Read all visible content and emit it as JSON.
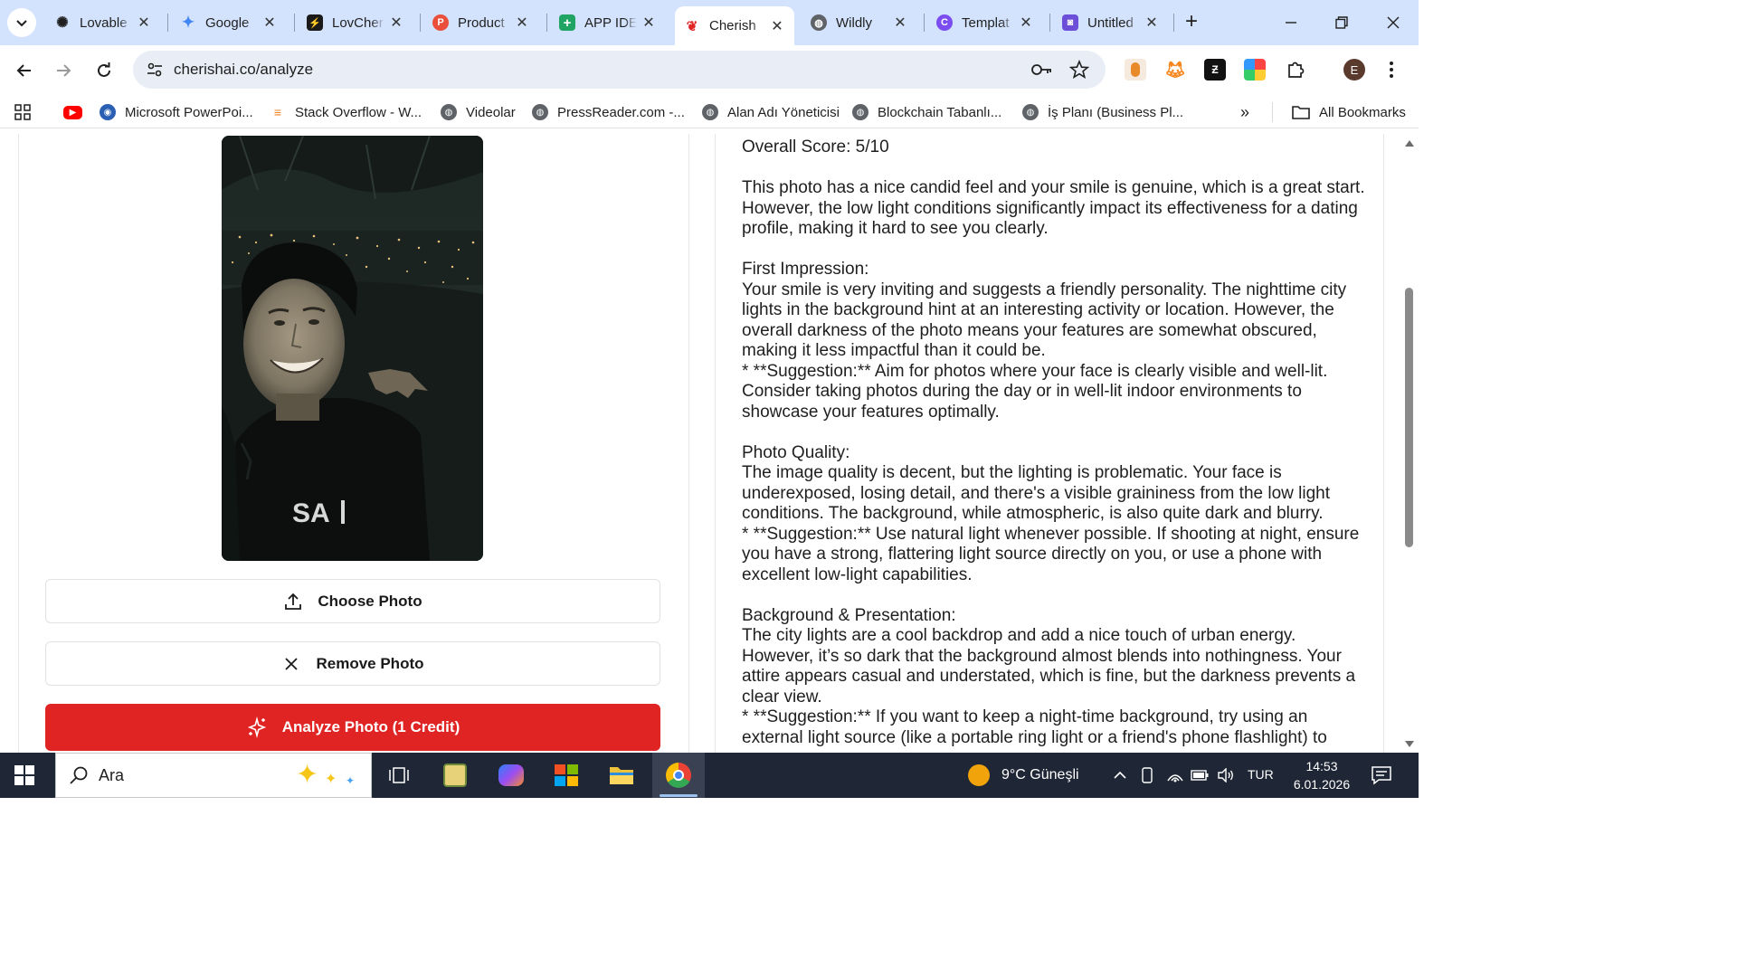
{
  "browser": {
    "tabs": [
      {
        "title": "Lovable",
        "active": false
      },
      {
        "title": "Google",
        "active": false
      },
      {
        "title": "LovCher",
        "active": false
      },
      {
        "title": "Product",
        "active": false
      },
      {
        "title": "APP IDE",
        "active": false
      },
      {
        "title": "Cherish",
        "active": true
      },
      {
        "title": "Wildly",
        "active": false
      },
      {
        "title": "Templat",
        "active": false
      },
      {
        "title": "Untitled",
        "active": false
      }
    ],
    "url": "cherishai.co/analyze",
    "profile_initial": "E",
    "bookmarks": [
      "Microsoft PowerPoi...",
      "Stack Overflow - W...",
      "Videolar",
      "PressReader.com -...",
      "Alan Adı Yöneticisi",
      "Blockchain Tabanlı...",
      "İş Planı (Business Pl..."
    ],
    "all_bookmarks_label": "All Bookmarks",
    "more_label": "»"
  },
  "left_panel": {
    "photo_shirt_text": "SA",
    "choose_label": "Choose Photo",
    "remove_label": "Remove Photo",
    "analyze_label": "Analyze Photo (1 Credit)"
  },
  "analysis": {
    "score": "Overall Score: 5/10",
    "intro": "This photo has a nice candid feel and your smile is genuine, which is a great start. However, the low light conditions significantly impact its effectiveness for a dating profile, making it hard to see you clearly.",
    "first_impression_heading": "First Impression:",
    "first_impression_body": "Your smile is very inviting and suggests a friendly personality. The nighttime city lights in the background hint at an interesting activity or location. However, the overall darkness of the photo means your features are somewhat obscured, making it less impactful than it could be.",
    "first_impression_suggestion": "*   **Suggestion:** Aim for photos where your face is clearly visible and well-lit. Consider taking photos during the day or in well-lit indoor environments to showcase your features optimally.",
    "photo_quality_heading": "Photo Quality:",
    "photo_quality_body": "The image quality is decent, but the lighting is problematic. Your face is underexposed, losing detail, and there's a visible graininess from the low light conditions. The background, while atmospheric, is also quite dark and blurry.",
    "photo_quality_suggestion": "*   **Suggestion:** Use natural light whenever possible. If shooting at night, ensure you have a strong, flattering light source directly on you, or use a phone with excellent low-light capabilities.",
    "background_heading": "Background & Presentation:",
    "background_body": "The city lights are a cool backdrop and add a nice touch of urban energy. However, it’s so dark that the background almost blends into nothingness. Your attire appears casual and understated, which is fine, but the darkness prevents a clear view.",
    "background_suggestion": "*   **Suggestion:** If you want to keep a night-time background, try using an external light source (like a portable ring light or a friend's phone flashlight) to"
  },
  "taskbar": {
    "search_placeholder": "Ara",
    "weather": "9°C Güneşli",
    "language": "TUR",
    "time": "14:53",
    "date": "6.01.2026"
  },
  "colors": {
    "accent_red": "#e02424",
    "tabstrip": "#d3e3fd",
    "taskbar": "#1f2635"
  }
}
